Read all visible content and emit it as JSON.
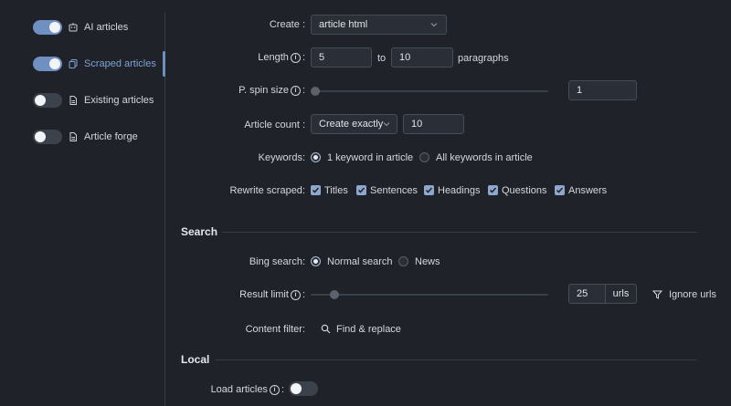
{
  "sidebar": {
    "items": [
      {
        "label": "AI articles",
        "on": true,
        "active": false,
        "icon": "robot-icon"
      },
      {
        "label": "Scraped articles",
        "on": true,
        "active": true,
        "icon": "copy-icon"
      },
      {
        "label": "Existing articles",
        "on": false,
        "active": false,
        "icon": "document-icon"
      },
      {
        "label": "Article forge",
        "on": false,
        "active": false,
        "icon": "document-icon"
      }
    ]
  },
  "form": {
    "create": {
      "label": "Create",
      "value": "article html"
    },
    "length": {
      "label": "Length",
      "from": "5",
      "to_label": "to",
      "to": "10",
      "unit": "paragraphs"
    },
    "spin": {
      "label": "P. spin size",
      "value": "1",
      "fraction": 0.0
    },
    "count": {
      "label": "Article count",
      "mode": "Create exactly",
      "value": "10"
    },
    "keywords": {
      "label": "Keywords",
      "option1": "1 keyword in article",
      "option2": "All keywords in article",
      "selected": 1
    },
    "rewrite": {
      "label": "Rewrite scraped",
      "options": [
        "Titles",
        "Sentences",
        "Headings",
        "Questions",
        "Answers"
      ]
    },
    "colon": ":"
  },
  "search": {
    "title": "Search",
    "bing": {
      "label": "Bing search",
      "option1": "Normal search",
      "option2": "News",
      "selected": 1
    },
    "limit": {
      "label": "Result limit",
      "value": "25",
      "unit": "urls",
      "fraction": 0.08
    },
    "ignore": "Ignore urls",
    "content_filter": {
      "label": "Content filter",
      "action": "Find & replace"
    }
  },
  "local": {
    "title": "Local",
    "load": {
      "label": "Load articles",
      "on": false
    }
  },
  "colors": {
    "accent": "#7190c2",
    "bg": "#1f2329",
    "input": "#2a2f37"
  }
}
